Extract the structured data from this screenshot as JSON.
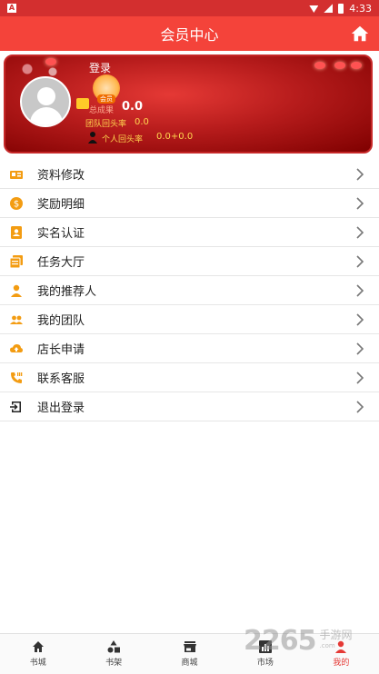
{
  "status_bar": {
    "app_badge": "A",
    "time": "4:33"
  },
  "header": {
    "title": "会员中心"
  },
  "profile": {
    "login_label": "登录",
    "vip_badge_text": "会员",
    "stat1_label": "总成果",
    "stat1_value": "0.0",
    "stat2_label": "团队回头率",
    "stat2_value": "0.0",
    "stat3_label": "个人回头率",
    "stat3_value": "0.0+0.0"
  },
  "menu": {
    "items": [
      {
        "label": "资料修改",
        "icon": "profile-card-icon"
      },
      {
        "label": "奖励明细",
        "icon": "dollar-coin-icon"
      },
      {
        "label": "实名认证",
        "icon": "id-badge-icon"
      },
      {
        "label": "任务大厅",
        "icon": "task-list-icon"
      },
      {
        "label": "我的推荐人",
        "icon": "person-icon"
      },
      {
        "label": "我的团队",
        "icon": "group-icon"
      },
      {
        "label": "店长申请",
        "icon": "cloud-upload-icon"
      },
      {
        "label": "联系客服",
        "icon": "phone-icon"
      },
      {
        "label": "退出登录",
        "icon": "exit-icon"
      }
    ]
  },
  "bottom_nav": {
    "items": [
      {
        "label": "书城",
        "icon": "home-icon"
      },
      {
        "label": "书架",
        "icon": "shapes-icon"
      },
      {
        "label": "商城",
        "icon": "store-icon"
      },
      {
        "label": "市场",
        "icon": "chart-icon"
      },
      {
        "label": "我的",
        "icon": "user-icon"
      }
    ],
    "active_index": 4
  },
  "watermark": {
    "number": "2265",
    "text": "手游网",
    "domain": ".com"
  },
  "colors": {
    "primary": "#f4433a",
    "icon_orange": "#f39c12",
    "active_nav": "#e53935"
  }
}
